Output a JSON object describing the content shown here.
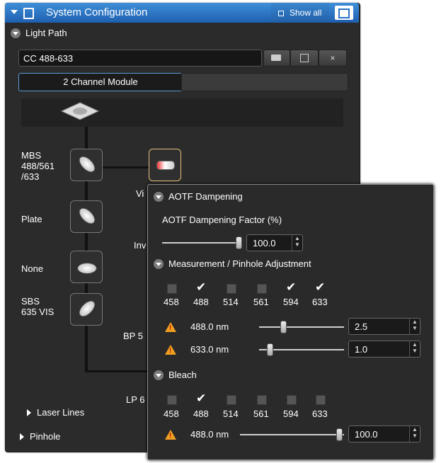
{
  "header": {
    "title": "System Configuration",
    "show_all": "Show all"
  },
  "light_path": {
    "section_label": "Light Path",
    "config_value": "CC 488-633",
    "module_tab": "2 Channel Module",
    "left_elements": [
      {
        "label": "MBS\n488/561\n/633"
      },
      {
        "label": "Plate"
      },
      {
        "label": "None"
      },
      {
        "label": "SBS\n635 VIS"
      }
    ],
    "partial_labels": {
      "vis": "Vi",
      "inv": "Inv",
      "bp": "BP 5",
      "lp": "LP 6"
    }
  },
  "collapsed_sections": {
    "laser_lines": "Laser Lines",
    "pinhole": "Pinhole"
  },
  "popup": {
    "aotf": {
      "section_label": "AOTF Dampening",
      "factor_label": "AOTF Dampening Factor (%)",
      "factor_value": "100.0",
      "factor_level": 1.0
    },
    "measurement": {
      "section_label": "Measurement / Pinhole Adjustment",
      "wavelengths": [
        "458",
        "488",
        "514",
        "561",
        "594",
        "633"
      ],
      "checked": [
        false,
        true,
        false,
        false,
        true,
        true
      ],
      "lines": [
        {
          "label": "488.0 nm",
          "value": "2.5"
        },
        {
          "label": "633.0 nm",
          "value": "1.0"
        }
      ]
    },
    "bleach": {
      "section_label": "Bleach",
      "wavelengths": [
        "458",
        "488",
        "514",
        "561",
        "594",
        "633"
      ],
      "checked": [
        false,
        true,
        false,
        false,
        false,
        false
      ],
      "lines": [
        {
          "label": "488.0 nm",
          "value": "100.0"
        }
      ]
    }
  },
  "colors": {
    "title_blue": "#2a74c8",
    "panel_bg": "#2b2b2b",
    "warning": "#f0a020"
  }
}
